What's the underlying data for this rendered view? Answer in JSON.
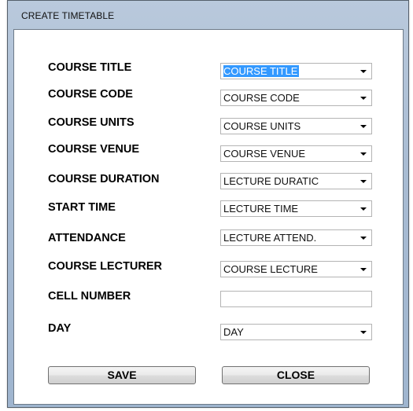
{
  "window": {
    "title": "CREATE TIMETABLE"
  },
  "form": {
    "fields": [
      {
        "label": "COURSE TITLE",
        "value": "COURSE TITLE",
        "type": "combo",
        "selected": true
      },
      {
        "label": "COURSE CODE",
        "value": "COURSE CODE",
        "type": "combo"
      },
      {
        "label": "COURSE UNITS",
        "value": "COURSE UNITS",
        "type": "combo"
      },
      {
        "label": "COURSE VENUE",
        "value": "COURSE VENUE",
        "type": "combo"
      },
      {
        "label": "COURSE DURATION",
        "value": "LECTURE DURATIC",
        "type": "combo"
      },
      {
        "label": "START TIME",
        "value": "LECTURE TIME",
        "type": "combo"
      },
      {
        "label": "ATTENDANCE",
        "value": "LECTURE ATTEND.",
        "type": "combo"
      },
      {
        "label": "COURSE LECTURER",
        "value": "COURSE LECTURE",
        "type": "combo"
      },
      {
        "label": "CELL NUMBER",
        "value": "",
        "type": "text"
      },
      {
        "label": "DAY",
        "value": "DAY",
        "type": "combo"
      }
    ]
  },
  "buttons": {
    "save_label": "SAVE",
    "close_label": "CLOSE"
  },
  "colors": {
    "frame": "#a9bcd3",
    "selection": "#3399ff",
    "client_bg": "#ffffff"
  },
  "icons": {
    "dropdown": "chevron-down-icon"
  }
}
